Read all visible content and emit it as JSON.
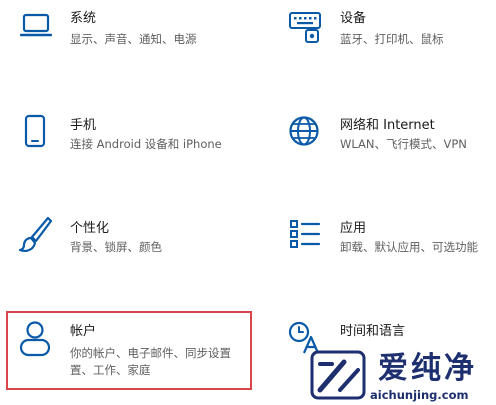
{
  "tiles": [
    {
      "title": "系统",
      "desc": "显示、声音、通知、电源"
    },
    {
      "title": "设备",
      "desc": "蓝牙、打印机、鼠标"
    },
    {
      "title": "手机",
      "desc": "连接 Android 设备和 iPhone"
    },
    {
      "title": "网络和 Internet",
      "desc": "WLAN、飞行模式、VPN"
    },
    {
      "title": "个性化",
      "desc": "背景、锁屏、颜色"
    },
    {
      "title": "应用",
      "desc": "卸载、默认应用、可选功能"
    },
    {
      "title": "帐户",
      "desc": "你的帐户、电子邮件、同步设置",
      "desc2": "置、工作、家庭"
    },
    {
      "title": "时间和语言",
      "desc": ""
    }
  ],
  "icons": {
    "system": "laptop-icon",
    "devices": "keyboard-icon",
    "phone": "phone-icon",
    "network": "globe-icon",
    "personalization": "brush-icon",
    "apps": "apps-list-icon",
    "accounts": "person-icon",
    "time": "time-language-icon"
  },
  "colors": {
    "icon": "#0a5aa8",
    "highlight_border": "#d9454a",
    "title": "#1a1a1a",
    "description": "#5f5f5f"
  },
  "watermark": {
    "text": "爱纯净",
    "url": "aichunjing.com"
  }
}
